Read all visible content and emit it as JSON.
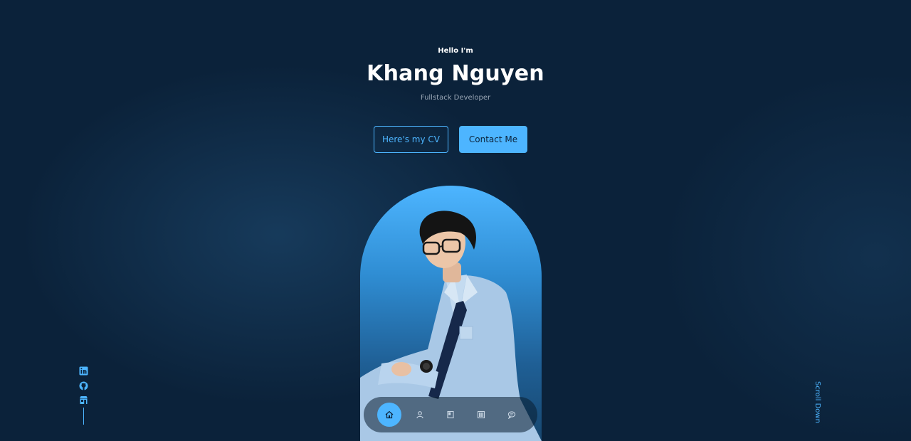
{
  "header": {
    "greeting": "Hello I'm",
    "name": "Khang Nguyen",
    "role": "Fullstack Developer"
  },
  "cta": {
    "cv_label": "Here's my CV",
    "contact_label": "Contact Me"
  },
  "nav": {
    "items": [
      {
        "icon": "home-icon",
        "active": true
      },
      {
        "icon": "user-icon",
        "active": false
      },
      {
        "icon": "book-icon",
        "active": false
      },
      {
        "icon": "portfolio-icon",
        "active": false
      },
      {
        "icon": "message-icon",
        "active": false
      }
    ]
  },
  "socials": [
    {
      "icon": "linkedin-icon"
    },
    {
      "icon": "github-icon"
    },
    {
      "icon": "store-icon"
    }
  ],
  "scroll_down_label": "Scroll Down",
  "colors": {
    "background": "#0b223a",
    "accent": "#4db5ff",
    "text": "#ffffff",
    "muted": "#9aa7b6"
  }
}
